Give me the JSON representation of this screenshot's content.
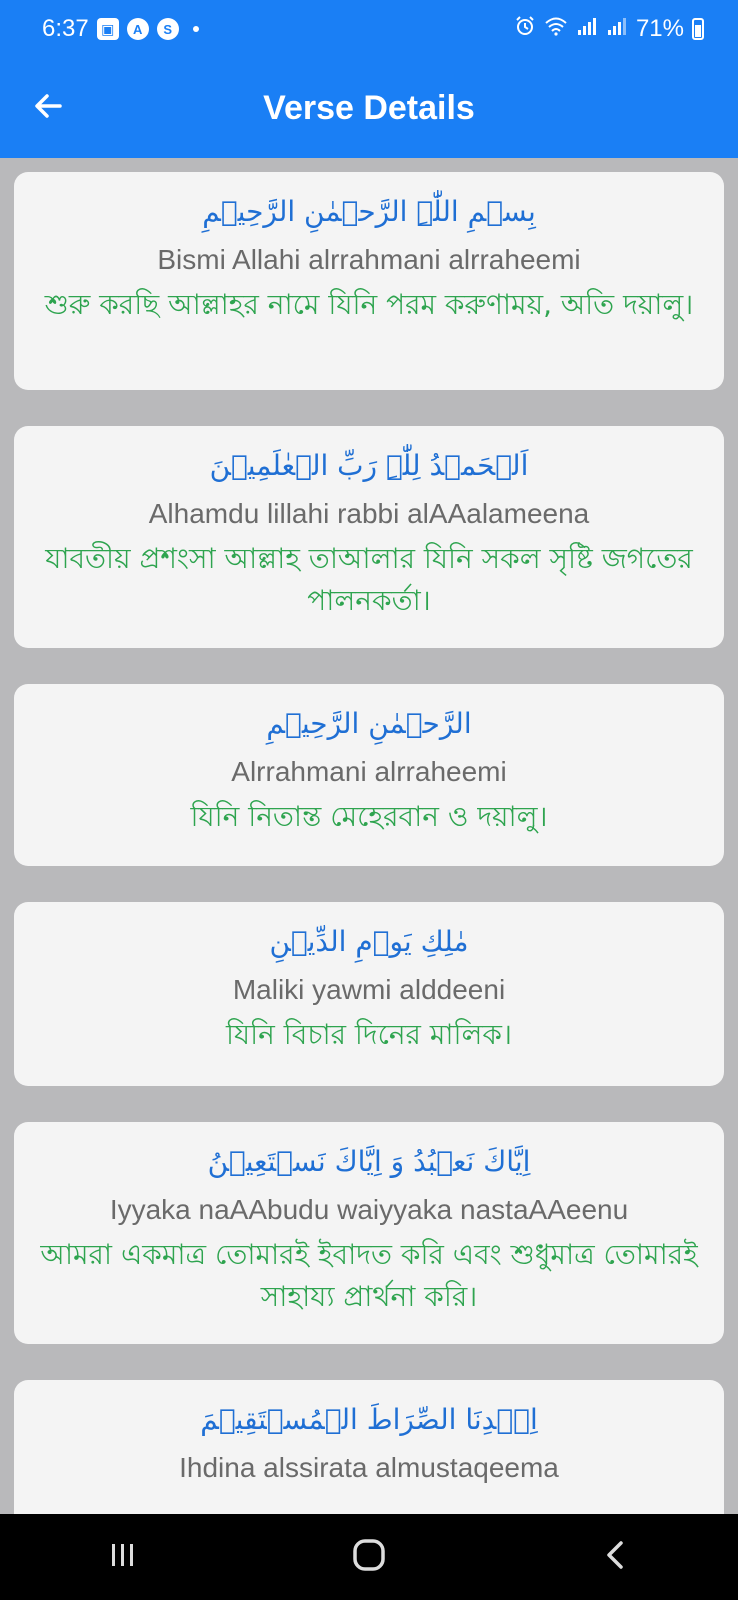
{
  "status": {
    "time": "6:37",
    "battery": "71%",
    "notif_icons": [
      "image-icon",
      "a-app-icon",
      "s-app-icon"
    ]
  },
  "appbar": {
    "title": "Verse Details",
    "back_icon": "arrow-left-icon",
    "color": "#1a7ff5"
  },
  "verses": [
    {
      "arabic": "بِسۡمِ اللّٰہِ الرَّحۡمٰنِ الرَّحِیۡمِ",
      "transliteration": "Bismi Allahi alrrahmani alrraheemi",
      "translation": "শুরু করছি আল্লাহর নামে যিনি পরম করুণাময়, অতি দয়ালু।"
    },
    {
      "arabic": "اَلۡحَمۡدُ لِلّٰہِ رَبِّ الۡعٰلَمِیۡنَ",
      "transliteration": "Alhamdu lillahi rabbi alAAalameena",
      "translation": "যাবতীয় প্রশংসা আল্লাহ তাআলার যিনি সকল সৃষ্টি জগতের পালনকর্তা।"
    },
    {
      "arabic": "الرَّحۡمٰنِ الرَّحِیۡمِ",
      "transliteration": "Alrrahmani alrraheemi",
      "translation": "যিনি নিতান্ত মেহেরবান ও দয়ালু।"
    },
    {
      "arabic": "مٰلِكِ یَوۡمِ الدِّیۡنِ",
      "transliteration": "Maliki yawmi alddeeni",
      "translation": "যিনি বিচার দিনের মালিক।"
    },
    {
      "arabic": "اِیَّاكَ نَعۡبُدُ وَ اِیَّاكَ نَسۡتَعِیۡنُ",
      "transliteration": "Iyyaka naAAbudu waiyyaka nastaAAeenu",
      "translation": "আমরা একমাত্র তোমারই ইবাদত করি এবং শুধুমাত্র তোমারই সাহায্য প্রার্থনা করি।"
    },
    {
      "arabic": "اِہۡدِنَا الصِّرَاطَ الۡمُسۡتَقِیۡمَ",
      "transliteration": "Ihdina alssirata almustaqeema",
      "translation": ""
    }
  ],
  "colors": {
    "arabic": "#1f6fd4",
    "transliteration": "#6a6a6a",
    "translation": "#2ea44f",
    "card": "#f4f4f4",
    "background": "#b9b9bb"
  },
  "navbar": {
    "icons": [
      "recent-apps-icon",
      "home-icon",
      "back-nav-icon"
    ]
  }
}
